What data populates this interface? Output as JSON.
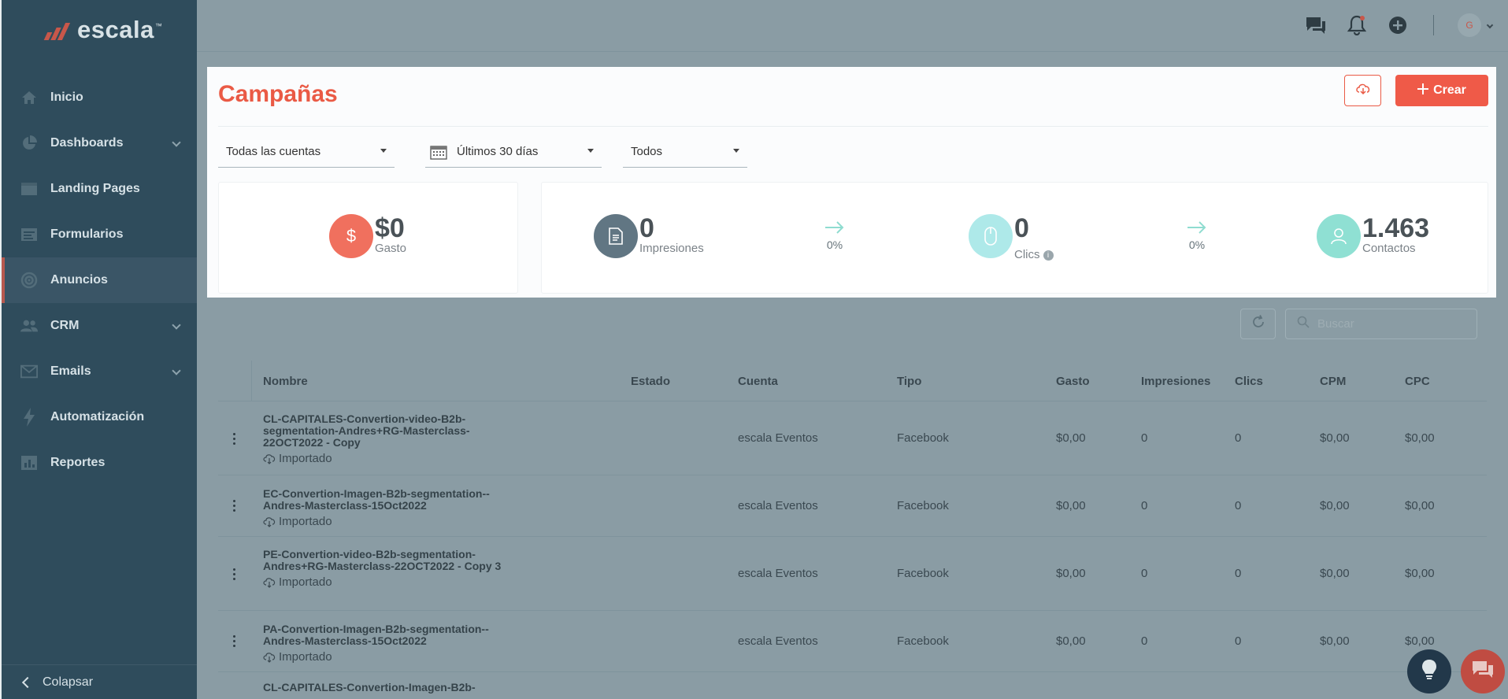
{
  "brand": {
    "name": "escala",
    "tm": "™"
  },
  "sidebar": {
    "items": [
      {
        "label": "Inicio",
        "icon": "home-icon",
        "chevron": false,
        "active": false
      },
      {
        "label": "Dashboards",
        "icon": "pie-chart-icon",
        "chevron": true,
        "active": false
      },
      {
        "label": "Landing Pages",
        "icon": "browser-icon",
        "chevron": false,
        "active": false
      },
      {
        "label": "Formularios",
        "icon": "form-icon",
        "chevron": false,
        "active": false
      },
      {
        "label": "Anuncios",
        "icon": "target-icon",
        "chevron": false,
        "active": true
      },
      {
        "label": "CRM",
        "icon": "people-icon",
        "chevron": true,
        "active": false
      },
      {
        "label": "Emails",
        "icon": "envelope-icon",
        "chevron": true,
        "active": false
      },
      {
        "label": "Automatización",
        "icon": "lightning-icon",
        "chevron": false,
        "active": false
      },
      {
        "label": "Reportes",
        "icon": "report-icon",
        "chevron": false,
        "active": false
      }
    ],
    "collapse_label": "Colapsar"
  },
  "topbar": {
    "avatar_initial": "G"
  },
  "page": {
    "title": "Campañas",
    "create_label": "Crear",
    "filters": {
      "account": "Todas las cuentas",
      "date_range": "Últimos 30 días",
      "status": "Todos"
    }
  },
  "stats": {
    "spend": {
      "value": "$0",
      "label": "Gasto"
    },
    "impressions": {
      "value": "0",
      "label": "Impresiones"
    },
    "impressions_to_clicks": "0%",
    "clicks": {
      "value": "0",
      "label": "Clics"
    },
    "clicks_to_contacts": "0%",
    "contacts": {
      "value": "1.463",
      "label": "Contactos"
    }
  },
  "search": {
    "placeholder": "Buscar"
  },
  "table": {
    "headers": {
      "name": "Nombre",
      "status": "Estado",
      "account": "Cuenta",
      "type": "Tipo",
      "spend": "Gasto",
      "impressions": "Impresiones",
      "clicks": "Clics",
      "cpm": "CPM",
      "cpc": "CPC"
    },
    "imported_label": "Importado",
    "rows": [
      {
        "name": "CL-CAPITALES-Convertion-video-B2b-segmentation-Andres+RG-Masterclass-22OCT2022 - Copy",
        "status": "",
        "account": "escala Eventos",
        "type": "Facebook",
        "spend": "$0,00",
        "impressions": "0",
        "clicks": "0",
        "cpm": "$0,00",
        "cpc": "$0,00"
      },
      {
        "name": "EC-Convertion-Imagen-B2b-segmentation--Andres-Masterclass-15Oct2022",
        "status": "",
        "account": "escala Eventos",
        "type": "Facebook",
        "spend": "$0,00",
        "impressions": "0",
        "clicks": "0",
        "cpm": "$0,00",
        "cpc": "$0,00"
      },
      {
        "name": "PE-Convertion-video-B2b-segmentation-Andres+RG-Masterclass-22OCT2022 - Copy 3",
        "status": "",
        "account": "escala Eventos",
        "type": "Facebook",
        "spend": "$0,00",
        "impressions": "0",
        "clicks": "0",
        "cpm": "$0,00",
        "cpc": "$0,00"
      },
      {
        "name": "PA-Convertion-Imagen-B2b-segmentation--Andres-Masterclass-15Oct2022",
        "status": "",
        "account": "escala Eventos",
        "type": "Facebook",
        "spend": "$0,00",
        "impressions": "0",
        "clicks": "0",
        "cpm": "$0,00",
        "cpc": "$0,00"
      },
      {
        "name": "CL-CAPITALES-Convertion-Imagen-B2b-",
        "status": "",
        "account": "",
        "type": "",
        "spend": "",
        "impressions": "",
        "clicks": "",
        "cpm": "",
        "cpc": ""
      }
    ]
  },
  "colors": {
    "accent": "#ea5a45",
    "sidebar": "#2f4c5c",
    "overlay": "#8a9ca4"
  }
}
